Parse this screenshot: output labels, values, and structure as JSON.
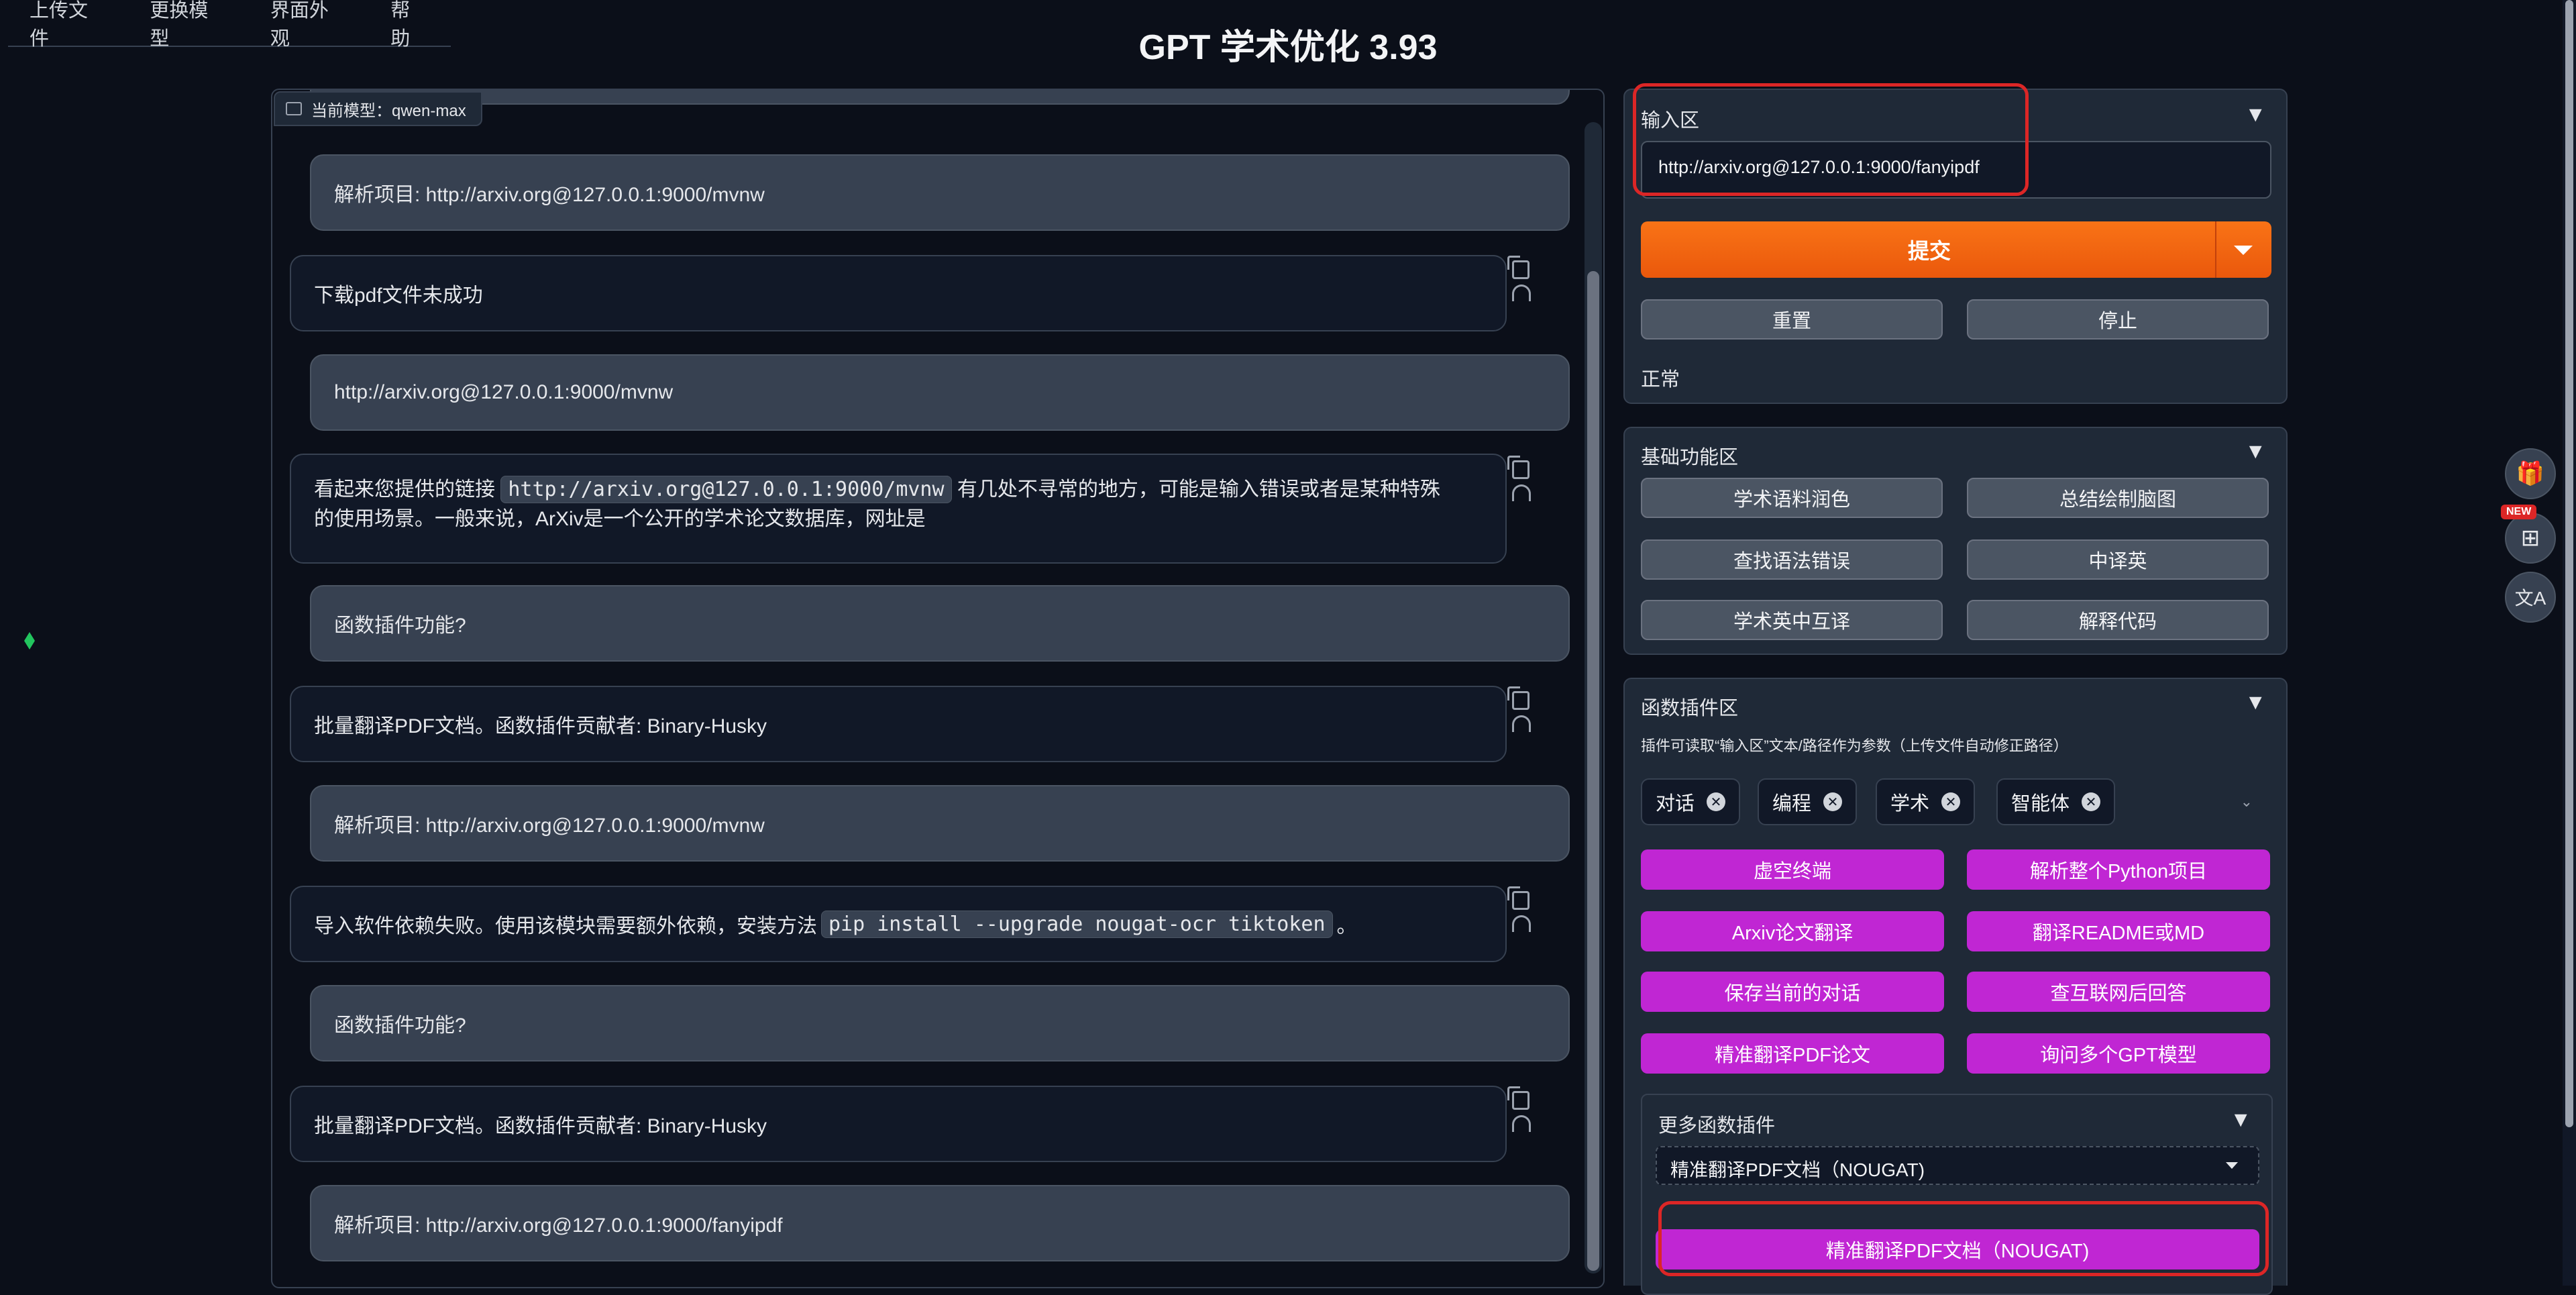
{
  "menu": [
    "上传文件",
    "更换模型",
    "界面外观",
    "帮助"
  ],
  "app_title": "GPT 学术优化 3.93",
  "chat": {
    "model_badge": "当前模型：qwen-max",
    "messages": [
      {
        "role": "user",
        "text": "解析项目: http://arxiv.org@127.0.0.1:9000/mvnw"
      },
      {
        "role": "bot",
        "text": "下载pdf文件未成功"
      },
      {
        "role": "user",
        "text": "http://arxiv.org@127.0.0.1:9000/mvnw"
      },
      {
        "role": "bot",
        "text_a": "看起来您提供的链接",
        "code": "http://arxiv.org@127.0.0.1:9000/mvnw",
        "text_b": "有几处不寻常的地方，可能是输入错误或者是某种特殊",
        "text_c": "的使用场景。一般来说，ArXiv是一个公开的学术论文数据库，网址是"
      },
      {
        "role": "user",
        "text": "函数插件功能?"
      },
      {
        "role": "bot",
        "text": "批量翻译PDF文档。函数插件贡献者: Binary-Husky"
      },
      {
        "role": "user",
        "text": "解析项目: http://arxiv.org@127.0.0.1:9000/mvnw"
      },
      {
        "role": "bot",
        "text_a": "导入软件依赖失败。使用该模块需要额外依赖，安装方法",
        "code": "pip install --upgrade nougat-ocr tiktoken",
        "text_b": "。"
      },
      {
        "role": "user",
        "text": "函数插件功能?"
      },
      {
        "role": "bot",
        "text": "批量翻译PDF文档。函数插件贡献者: Binary-Husky"
      },
      {
        "role": "user",
        "text": "解析项目: http://arxiv.org@127.0.0.1:9000/fanyipdf"
      }
    ]
  },
  "input_panel": {
    "title": "输入区",
    "input_value": "http://arxiv.org@127.0.0.1:9000/fanyipdf",
    "submit_label": "提交",
    "reset_label": "重置",
    "stop_label": "停止",
    "status": "正常"
  },
  "basic_panel": {
    "title": "基础功能区",
    "buttons": [
      "学术语料润色",
      "总结绘制脑图",
      "查找语法错误",
      "中译英",
      "学术英中互译",
      "解释代码"
    ]
  },
  "plugin_panel": {
    "title": "函数插件区",
    "hint": "插件可读取“输入区”文本/路径作为参数（上传文件自动修正路径）",
    "chips": [
      "对话",
      "编程",
      "学术",
      "智能体"
    ],
    "buttons": [
      "虚空终端",
      "解析整个Python项目",
      "Arxiv论文翻译",
      "翻译README或MD",
      "保存当前的对话",
      "查互联网后回答",
      "精准翻译PDF论文",
      "询问多个GPT模型"
    ],
    "more_title": "更多函数插件",
    "dropdown_value": "精准翻译PDF文档（NOUGAT)",
    "run_label": "精准翻译PDF文档（NOUGAT)"
  },
  "floating": {
    "new_badge": "NEW"
  },
  "colors": {
    "accent_orange": "#f97316",
    "plugin_purple": "#c026d3",
    "highlight_red": "#dc2626",
    "background": "#0b0f19"
  }
}
